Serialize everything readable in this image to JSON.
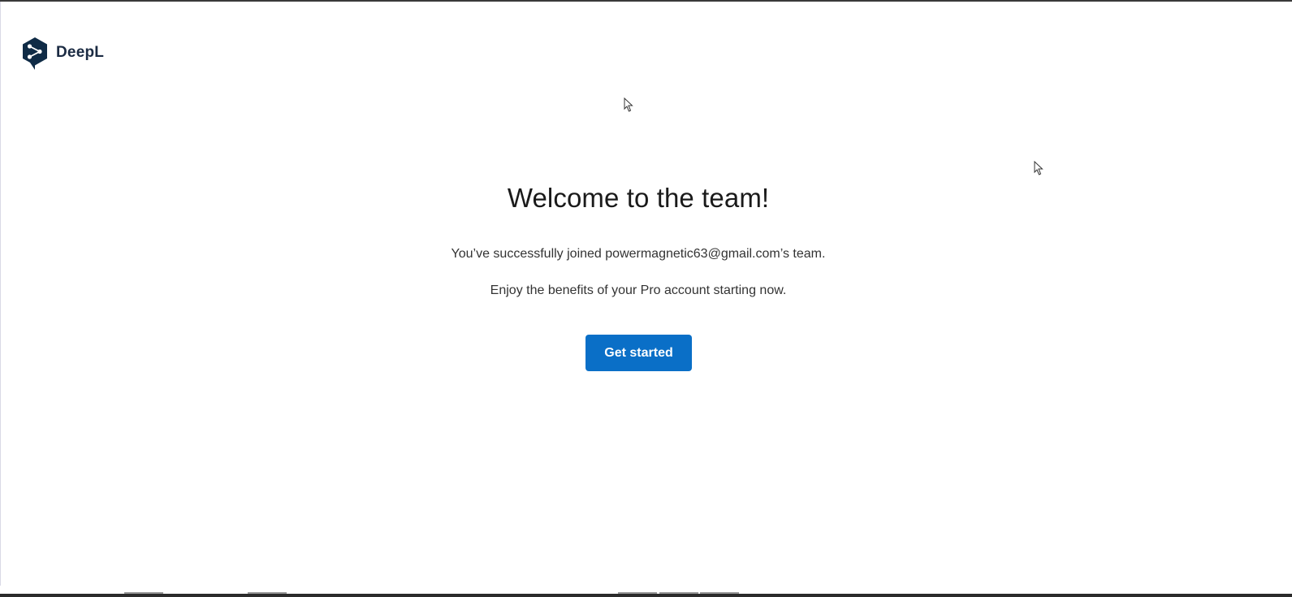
{
  "brand": {
    "name": "DeepL",
    "logo_icon": "deepl-logo-icon",
    "color": "#0f2b46"
  },
  "main": {
    "title": "Welcome to the team!",
    "joined_text": "You’ve successfully joined powermagnetic63@gmail.com’s team.",
    "benefits_text": "Enjoy the benefits of your Pro account starting now.",
    "cta_label": "Get started"
  },
  "colors": {
    "accent": "#0a6fc7",
    "text": "#1a1a1a",
    "background": "#ffffff"
  }
}
